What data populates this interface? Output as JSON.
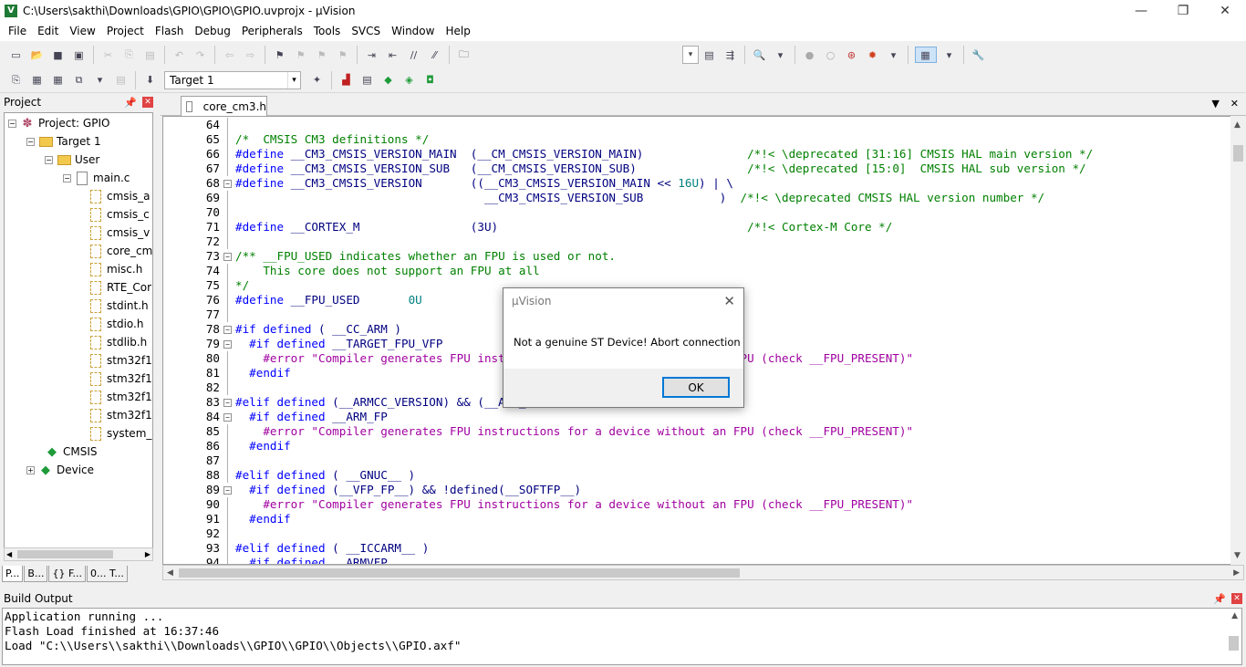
{
  "window": {
    "title": "C:\\Users\\sakthi\\Downloads\\GPIO\\GPIO\\GPIO.uvprojx - µVision",
    "minimize_label": "—",
    "restore_label": "❐",
    "close_label": "✕"
  },
  "menu": [
    "File",
    "Edit",
    "View",
    "Project",
    "Flash",
    "Debug",
    "Peripherals",
    "Tools",
    "SVCS",
    "Window",
    "Help"
  ],
  "toolbar2": {
    "target": "Target 1"
  },
  "project_panel": {
    "title": "Project",
    "tree": [
      {
        "label": "Project: GPIO",
        "icon": "project-icon",
        "level": 0,
        "expander": "−"
      },
      {
        "label": "Target 1",
        "icon": "target-folder-icon",
        "level": 1,
        "expander": "−"
      },
      {
        "label": "User",
        "icon": "folder-icon",
        "level": 2,
        "expander": "−"
      },
      {
        "label": "main.c",
        "icon": "c-file-icon",
        "level": 3,
        "expander": "−"
      },
      {
        "label": "cmsis_a",
        "icon": "header-file-icon",
        "level": 4
      },
      {
        "label": "cmsis_c",
        "icon": "header-file-icon",
        "level": 4
      },
      {
        "label": "cmsis_v",
        "icon": "header-file-icon",
        "level": 4
      },
      {
        "label": "core_cm",
        "icon": "header-file-icon",
        "level": 4
      },
      {
        "label": "misc.h",
        "icon": "header-file-icon",
        "level": 4
      },
      {
        "label": "RTE_Cor",
        "icon": "header-file-icon",
        "level": 4
      },
      {
        "label": "stdint.h",
        "icon": "header-file-icon",
        "level": 4
      },
      {
        "label": "stdio.h",
        "icon": "header-file-icon",
        "level": 4
      },
      {
        "label": "stdlib.h",
        "icon": "header-file-icon",
        "level": 4
      },
      {
        "label": "stm32f1",
        "icon": "header-file-icon",
        "level": 4
      },
      {
        "label": "stm32f1",
        "icon": "header-file-icon",
        "level": 4
      },
      {
        "label": "stm32f1",
        "icon": "header-file-icon",
        "level": 4
      },
      {
        "label": "stm32f1",
        "icon": "header-file-icon",
        "level": 4
      },
      {
        "label": "system_",
        "icon": "header-file-icon",
        "level": 4
      },
      {
        "label": "CMSIS",
        "icon": "cmsis-gem-icon",
        "level": 2
      },
      {
        "label": "Device",
        "icon": "device-gem-icon",
        "level": 1,
        "expander": "+"
      }
    ],
    "bottom_tabs": [
      "P...",
      "B...",
      "{} F...",
      "0... T..."
    ]
  },
  "editor": {
    "tab": "core_cm3.h",
    "lines": [
      {
        "n": "64",
        "fold": "",
        "segs": []
      },
      {
        "n": "65",
        "fold": "",
        "segs": [
          [
            "c-comment",
            "/*  CMSIS CM3 definitions */"
          ]
        ]
      },
      {
        "n": "66",
        "fold": "",
        "segs": [
          [
            "c-kw",
            "#define "
          ],
          [
            "c-def",
            "__CM3_CMSIS_VERSION_MAIN  (__CM_CMSIS_VERSION_MAIN)               "
          ],
          [
            "c-comment",
            "/*!< \\deprecated [31:16] CMSIS HAL main version */"
          ]
        ]
      },
      {
        "n": "67",
        "fold": "",
        "segs": [
          [
            "c-kw",
            "#define "
          ],
          [
            "c-def",
            "__CM3_CMSIS_VERSION_SUB   (__CM_CMSIS_VERSION_SUB)                "
          ],
          [
            "c-comment",
            "/*!< \\deprecated [15:0]  CMSIS HAL sub version */"
          ]
        ]
      },
      {
        "n": "68",
        "fold": "−",
        "segs": [
          [
            "c-kw",
            "#define "
          ],
          [
            "c-def",
            "__CM3_CMSIS_VERSION       ((__CM3_CMSIS_VERSION_MAIN << "
          ],
          [
            "c-num",
            "16U"
          ],
          [
            "c-def",
            ") | \\"
          ]
        ]
      },
      {
        "n": "69",
        "fold": "",
        "segs": [
          [
            "c-def",
            "                                    __CM3_CMSIS_VERSION_SUB           )  "
          ],
          [
            "c-comment",
            "/*!< \\deprecated CMSIS HAL version number */"
          ]
        ]
      },
      {
        "n": "70",
        "fold": "",
        "segs": []
      },
      {
        "n": "71",
        "fold": "",
        "segs": [
          [
            "c-kw",
            "#define "
          ],
          [
            "c-def",
            "__CORTEX_M                (3U)                                    "
          ],
          [
            "c-comment",
            "/*!< Cortex-M Core */"
          ]
        ]
      },
      {
        "n": "72",
        "fold": "",
        "segs": []
      },
      {
        "n": "73",
        "fold": "−",
        "segs": [
          [
            "c-comment",
            "/** __FPU_USED indicates whether an FPU is used or not."
          ]
        ]
      },
      {
        "n": "74",
        "fold": "",
        "segs": [
          [
            "c-comment",
            "    This core does not support an FPU at all"
          ]
        ]
      },
      {
        "n": "75",
        "fold": "",
        "segs": [
          [
            "c-comment",
            "*/"
          ]
        ]
      },
      {
        "n": "76",
        "fold": "",
        "segs": [
          [
            "c-kw",
            "#define "
          ],
          [
            "c-def",
            "__FPU_USED       "
          ],
          [
            "c-num",
            "0U"
          ]
        ]
      },
      {
        "n": "77",
        "fold": "",
        "segs": []
      },
      {
        "n": "78",
        "fold": "−",
        "segs": [
          [
            "c-kw",
            "#if defined "
          ],
          [
            "c-def",
            "( __CC_ARM )"
          ]
        ]
      },
      {
        "n": "79",
        "fold": "−",
        "segs": [
          [
            "c-kw",
            "  #if defined "
          ],
          [
            "c-def",
            "__TARGET_FPU_VFP"
          ]
        ]
      },
      {
        "n": "80",
        "fold": "",
        "segs": [
          [
            "c-err",
            "    #error "
          ],
          [
            "c-str",
            "\"Compiler generates FPU instructions for a device without an FPU (check __FPU_PRESENT)\""
          ]
        ]
      },
      {
        "n": "81",
        "fold": "",
        "segs": [
          [
            "c-kw",
            "  #endif"
          ]
        ]
      },
      {
        "n": "82",
        "fold": "",
        "segs": []
      },
      {
        "n": "83",
        "fold": "−",
        "segs": [
          [
            "c-kw",
            "#elif defined "
          ],
          [
            "c-def",
            "(__ARMCC_VERSION) && (__ARM_FP)"
          ]
        ]
      },
      {
        "n": "84",
        "fold": "−",
        "segs": [
          [
            "c-kw",
            "  #if defined "
          ],
          [
            "c-def",
            "__ARM_FP"
          ]
        ]
      },
      {
        "n": "85",
        "fold": "",
        "segs": [
          [
            "c-err",
            "    #error "
          ],
          [
            "c-str",
            "\"Compiler generates FPU instructions for a device without an FPU (check __FPU_PRESENT)\""
          ]
        ]
      },
      {
        "n": "86",
        "fold": "",
        "segs": [
          [
            "c-kw",
            "  #endif"
          ]
        ]
      },
      {
        "n": "87",
        "fold": "",
        "segs": []
      },
      {
        "n": "88",
        "fold": "",
        "segs": [
          [
            "c-kw",
            "#elif defined "
          ],
          [
            "c-def",
            "( __GNUC__ )"
          ]
        ]
      },
      {
        "n": "89",
        "fold": "−",
        "segs": [
          [
            "c-kw",
            "  #if defined "
          ],
          [
            "c-def",
            "(__VFP_FP__) && !defined(__SOFTFP__)"
          ]
        ]
      },
      {
        "n": "90",
        "fold": "",
        "segs": [
          [
            "c-err",
            "    #error "
          ],
          [
            "c-str",
            "\"Compiler generates FPU instructions for a device without an FPU (check __FPU_PRESENT)\""
          ]
        ]
      },
      {
        "n": "91",
        "fold": "",
        "segs": [
          [
            "c-kw",
            "  #endif"
          ]
        ]
      },
      {
        "n": "92",
        "fold": "",
        "segs": []
      },
      {
        "n": "93",
        "fold": "",
        "segs": [
          [
            "c-kw",
            "#elif defined "
          ],
          [
            "c-def",
            "( __ICCARM__ )"
          ]
        ]
      },
      {
        "n": "94",
        "fold": "",
        "segs": [
          [
            "c-kw",
            "  #if defined "
          ],
          [
            "c-def",
            "__ARMVFP__"
          ]
        ]
      }
    ]
  },
  "build_output": {
    "title": "Build Output",
    "lines": [
      "Application running ...",
      "Flash Load finished at 16:37:46",
      "Load \"C:\\\\Users\\\\sakthi\\\\Downloads\\\\GPIO\\\\GPIO\\\\Objects\\\\GPIO.axf\""
    ]
  },
  "dialog": {
    "title": "µVision",
    "message": "Not a genuine ST Device! Abort connection",
    "ok_label": "OK"
  }
}
